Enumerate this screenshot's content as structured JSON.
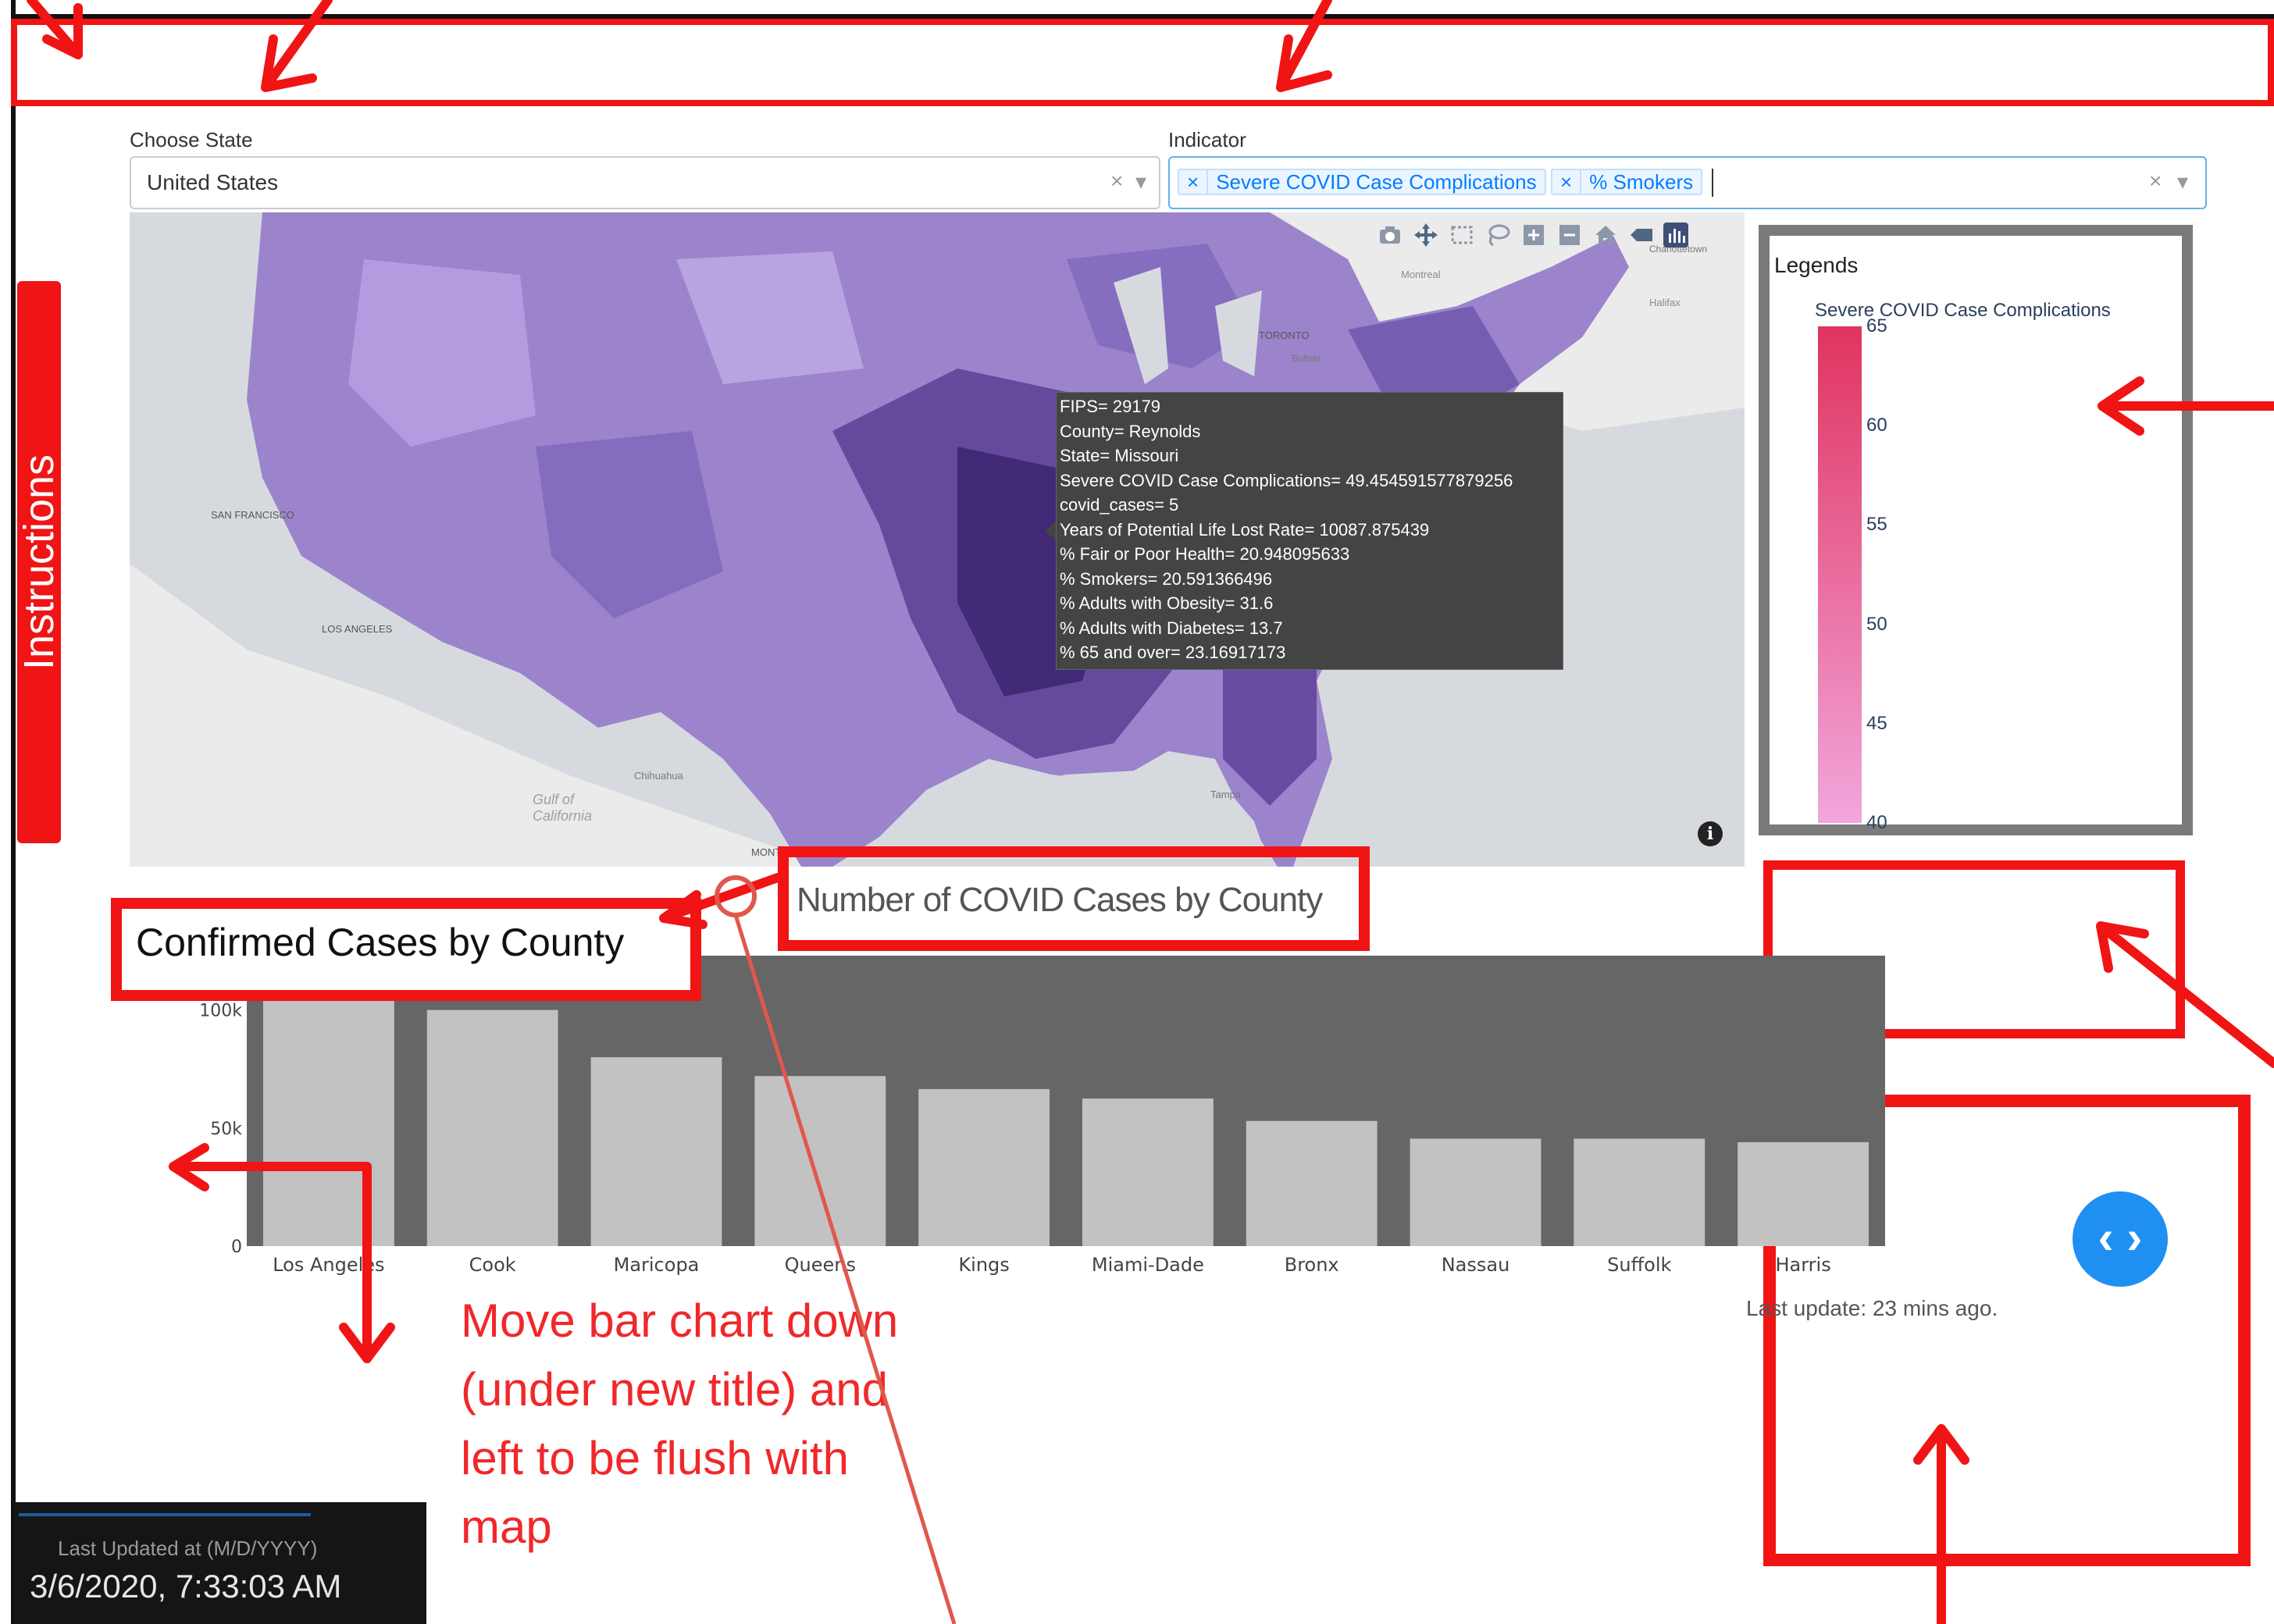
{
  "filters": {
    "state_label": "Choose State",
    "state_value": "United States",
    "indicator_label": "Indicator",
    "indicator_tags": [
      "Severe COVID Case Complications",
      "% Smokers"
    ],
    "clear_glyph": "×",
    "remove_glyph": "×",
    "caret_glyph": "▾"
  },
  "map": {
    "labels": [
      "Montreal",
      "Halifax",
      "TORONTO",
      "Buffalo",
      "SAN FRANCISCO",
      "LOS ANGELES",
      "Chihuahua",
      "Gulf of California",
      "MONTERREY",
      "Tampa",
      "Charlottetown"
    ],
    "toolbar_icons": [
      "camera-icon",
      "pan-icon",
      "box-select-icon",
      "lasso-icon",
      "zoom-in-icon",
      "zoom-out-icon",
      "home-icon",
      "reset-icon",
      "plotly-logo-icon"
    ],
    "info_glyph": "i",
    "tooltip": [
      "FIPS= 29179",
      "County= Reynolds",
      "State= Missouri",
      "Severe COVID Case Complications= 49.454591577879256",
      "covid_cases= 5",
      "Years of Potential Life Lost Rate= 10087.875439",
      "% Fair or Poor Health= 20.948095633",
      "% Smokers= 20.591366496",
      "% Adults with Obesity= 31.6",
      "% Adults with Diabetes= 13.7",
      "% 65 and over= 23.16917173"
    ]
  },
  "legend": {
    "heading": "Legends",
    "colorbar_title": "Severe COVID Case Complications",
    "ticks": [
      "65",
      "60",
      "55",
      "50",
      "45",
      "40"
    ],
    "tick_values": [
      65,
      60,
      55,
      50,
      45,
      40
    ],
    "range": [
      40,
      65
    ],
    "color_top": "#e0345f",
    "color_bottom": "#f2a6dc"
  },
  "chart_title_old": "Confirmed Cases by County",
  "chart_title_new": "Number of COVID Cases by County",
  "chart_data": {
    "type": "bar",
    "categories": [
      "Los Angeles",
      "Cook",
      "Maricopa",
      "Queens",
      "Kings",
      "Miami-Dade",
      "Bronx",
      "Nassau",
      "Suffolk",
      "Harris"
    ],
    "values": [
      123000,
      100000,
      80000,
      72000,
      66500,
      62500,
      53000,
      45500,
      45500,
      44000
    ],
    "ylim": [
      0,
      123000
    ],
    "yticks": [
      "0",
      "50k",
      "100k"
    ],
    "ytick_values": [
      0,
      50000,
      100000
    ],
    "bar_color": "#c2c2c2",
    "plot_bg": "#666666"
  },
  "sidebar": {
    "instructions_label": "Instructions"
  },
  "update": {
    "text": "Last update: 23 mins ago.",
    "stamp_label": "Last Updated at (M/D/YYYY)",
    "stamp_value": "3/6/2020, 7:33:03 AM"
  },
  "nav_button_glyph": "‹ ›",
  "annotation": {
    "lines": [
      "Move bar chart down",
      "(under new title) and",
      "left to be flush with",
      "map"
    ]
  },
  "colors": {
    "accent_red": "#f01414",
    "nav_blue": "#1f8ff2",
    "tag_blue": "#007eff",
    "legend_frame": "#7a7a7a"
  }
}
